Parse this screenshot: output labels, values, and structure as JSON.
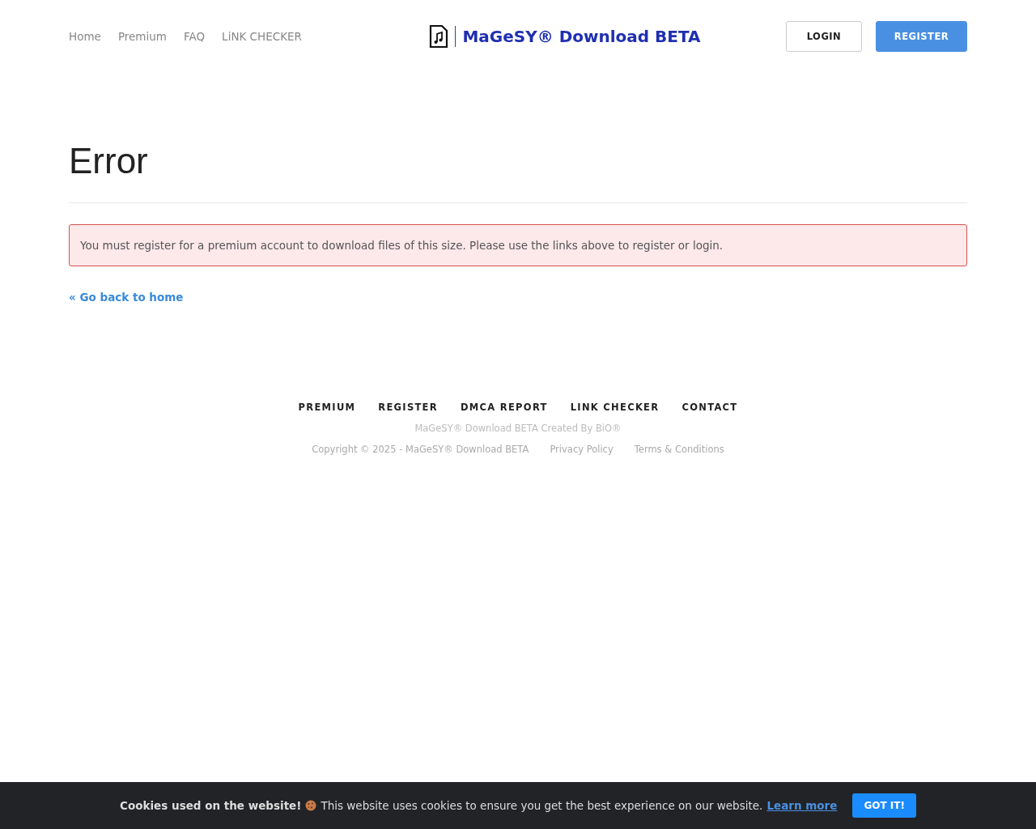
{
  "nav": {
    "links": [
      "Home",
      "Premium",
      "FAQ",
      "LiNK CHECKER"
    ],
    "logo": "MaGeSY® Download BETA",
    "buttons": [
      {
        "label": "LOGIN",
        "kind": "outline"
      },
      {
        "label": "REGISTER",
        "kind": "primary"
      }
    ]
  },
  "page": {
    "title": "Error",
    "alert": "You must register for a premium account to download files of this size. Please use the links above to register or login.",
    "back_link": "« Go back to home"
  },
  "footer": {
    "links": [
      "PREMIUM",
      "REGISTER",
      "DMCA REPORT",
      "LINK CHECKER",
      "CONTACT"
    ],
    "credit": "MaGeSY® Download BETA Created By BiO®",
    "copyright": "Copyright © 2025 - MaGeSY® Download BETA",
    "legal": [
      "Privacy Policy",
      "Terms & Conditions"
    ]
  },
  "cookie_bar": {
    "title": "Cookies used on the website!",
    "text": "This website uses cookies to ensure you get the best experience on our website.",
    "link": "Learn more",
    "button": "GOT IT!"
  }
}
